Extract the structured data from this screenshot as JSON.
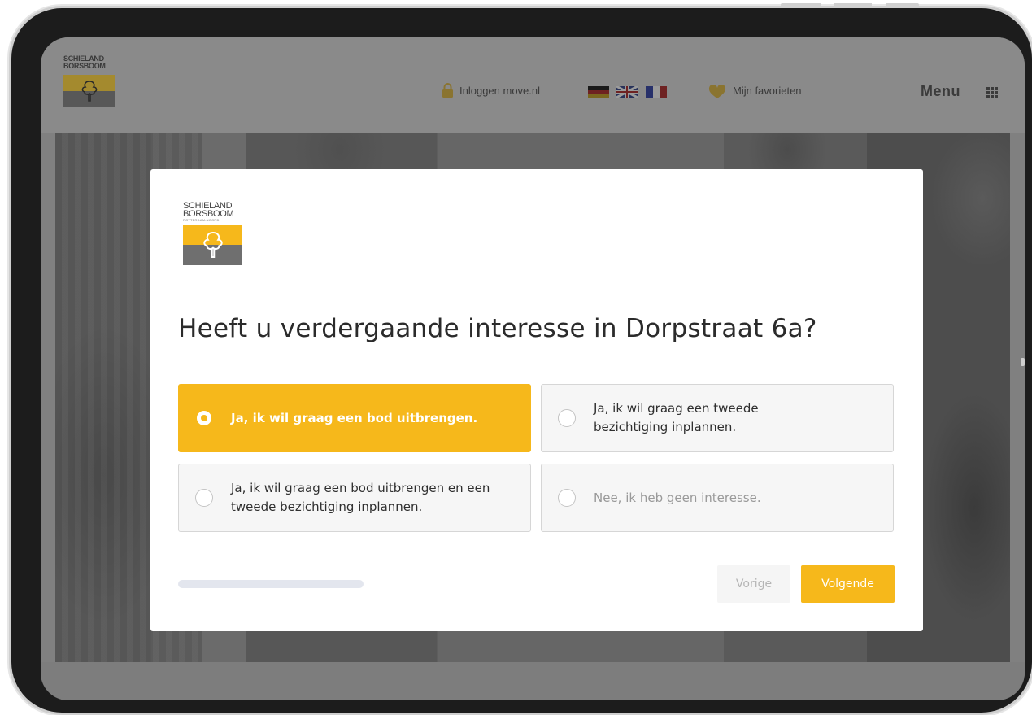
{
  "site": {
    "logo_line1": "SCHIELAND",
    "logo_line2": "BORSBOOM",
    "login_label": "Inloggen move.nl",
    "favorites_label": "Mijn favorieten",
    "menu_label": "Menu",
    "languages": [
      "German flag",
      "British flag",
      "French flag"
    ]
  },
  "modal": {
    "logo_line1": "SCHIELAND",
    "logo_line2": "BORSBOOM",
    "logo_sub": "ROTTERDAM-NOORD",
    "question": "Heeft u verdergaande interesse in Dorpstraat 6a?",
    "options": [
      {
        "label": "Ja, ik wil graag een bod uitbrengen.",
        "selected": true
      },
      {
        "label": "Ja, ik wil graag een tweede bezichtiging inplannen.",
        "selected": false
      },
      {
        "label": "Ja, ik wil graag een bod uitbrengen en een tweede bezichtiging inplannen.",
        "selected": false
      },
      {
        "label": "Nee, ik heb geen interesse.",
        "selected": false
      }
    ],
    "progress": 0.0,
    "prev_label": "Vorige",
    "next_label": "Volgende"
  },
  "colors": {
    "accent": "#f6b81b",
    "overlay": "#808080",
    "text": "#2b2b2b"
  },
  "icons": [
    "lock-icon",
    "heart-icon",
    "grid-icon",
    "tree-logo-icon",
    "radio-icon"
  ]
}
